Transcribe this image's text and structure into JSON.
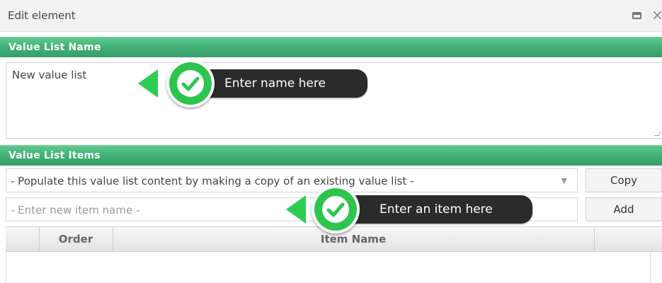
{
  "window": {
    "title": "Edit element",
    "maximize_icon": "maximize-icon",
    "close_glyph": "×"
  },
  "sections": {
    "name_header": "Value List Name",
    "items_header": "Value List Items"
  },
  "name_field": {
    "value": "New value list"
  },
  "populate_select": {
    "selected": "- Populate this value list content by making a copy of an existing value list -",
    "arrow": "▼"
  },
  "buttons": {
    "copy": "Copy",
    "add": "Add"
  },
  "new_item_input": {
    "placeholder": "- Enter new item name -"
  },
  "table": {
    "columns": [
      "",
      "Order",
      "Item Name",
      ""
    ]
  },
  "callouts": {
    "name_hint": "Enter name here",
    "item_hint": "Enter an item here"
  },
  "colors": {
    "header_green": "#3fae73",
    "callout_green": "#2ec54f",
    "callout_dark": "#2b2b2b"
  }
}
